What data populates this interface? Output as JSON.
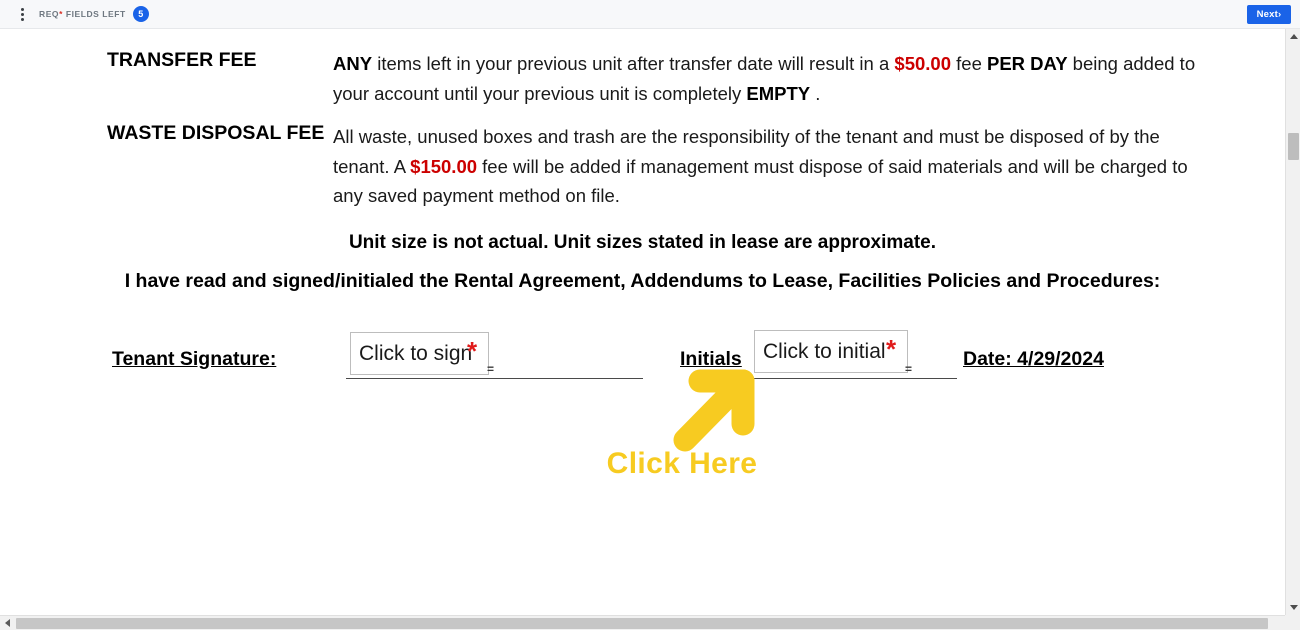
{
  "toolbar": {
    "menu_icon": "kebab-menu-icon",
    "req_fields_label_pre": "REQ",
    "req_fields_label_star": "*",
    "req_fields_label_post": " FIELDS LEFT",
    "req_fields_count": "5",
    "next_label": "Next›",
    "accent_color": "#1a63e8",
    "required_star_color": "#d93025"
  },
  "document": {
    "clauses": [
      {
        "label": "TRANSFER FEE",
        "segments": [
          {
            "text": "ANY",
            "style": "bold"
          },
          {
            "text": " items left in your previous unit after transfer date will result in a ",
            "style": "normal"
          },
          {
            "text": "$50.00",
            "style": "money"
          },
          {
            "text": " fee ",
            "style": "normal"
          },
          {
            "text": "PER DAY",
            "style": "bold"
          },
          {
            "text": " being added to your account until your previous unit is completely ",
            "style": "normal"
          },
          {
            "text": "EMPTY",
            "style": "bold"
          },
          {
            "text": " .",
            "style": "normal"
          }
        ]
      },
      {
        "label": "WASTE DISPOSAL FEE",
        "segments": [
          {
            "text": "All waste, unused boxes and trash are the responsibility of the tenant and must be disposed of by the tenant.  A ",
            "style": "normal"
          },
          {
            "text": "$150.00",
            "style": "money"
          },
          {
            "text": " fee will be added if management must dispose of said materials and will be charged to any saved payment method on file.",
            "style": "normal"
          }
        ]
      }
    ],
    "centered_lines": [
      "Unit size is not actual. Unit sizes stated in lease are approximate.",
      "I have read and signed/initialed the Rental Agreement, Addendums to Lease, Facilities Policies and Procedures:"
    ],
    "signature_row": {
      "tenant_signature_label": "Tenant Signature:",
      "sign_field_text": "Click to sign",
      "sign_field_required_marker": "*",
      "sign_field_eq_marker": "=",
      "initials_label": "Initials",
      "initials_field_text": "Click to initial",
      "initials_field_required_marker": "*",
      "initials_field_eq_marker": "=",
      "date_label": "Date:  4/29/2024"
    },
    "annotation": {
      "arrow_icon": "up-right-arrow-icon",
      "text": "Click Here",
      "color": "#F7CB21"
    },
    "money_color": "#cc0000"
  },
  "scrollbars": {
    "vertical_up_icon": "chevron-up-icon",
    "vertical_down_icon": "chevron-down-icon",
    "horizontal_left_icon": "chevron-left-icon",
    "horizontal_right_icon": "chevron-right-icon"
  }
}
